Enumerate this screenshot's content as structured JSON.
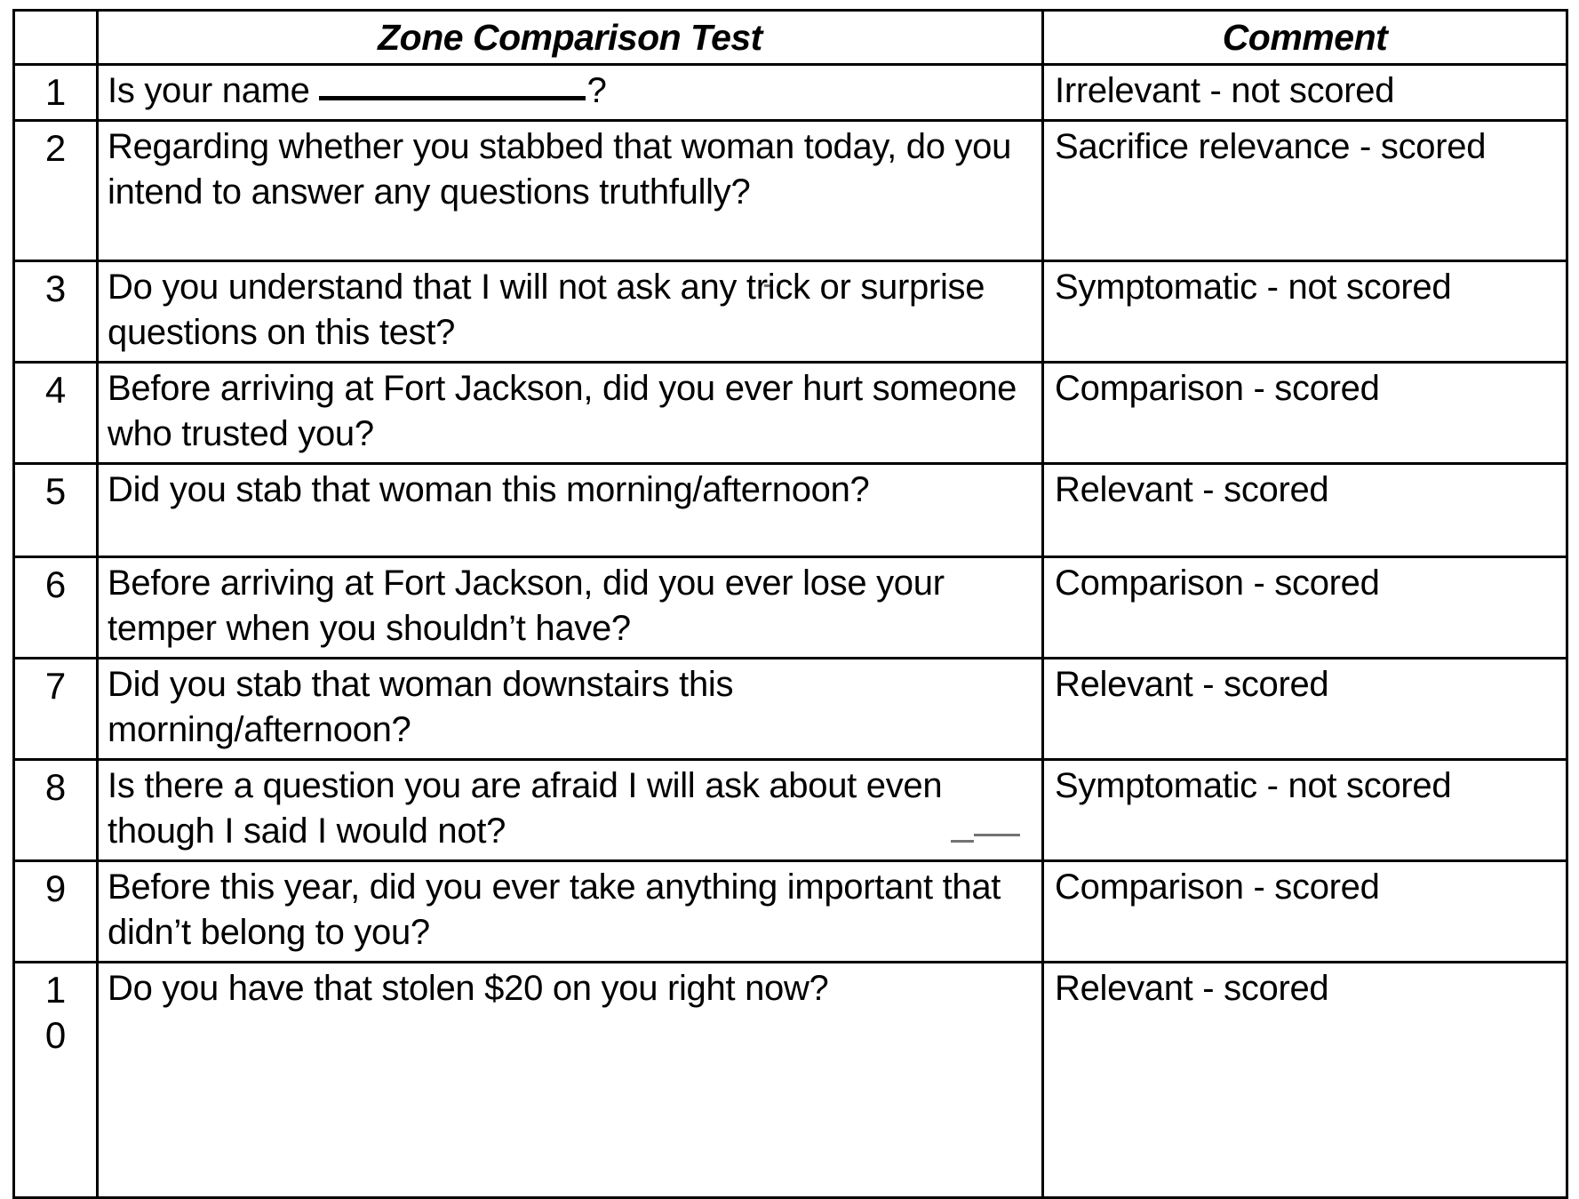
{
  "table": {
    "headers": {
      "number": "",
      "question": "Zone Comparison Test",
      "comment": "Comment"
    },
    "rows": [
      {
        "number": "1",
        "question_before_blank": "Is your name",
        "question_after_blank": "?",
        "has_blank": true,
        "question": "Is your name ______________?",
        "comment": "Irrelevant - not scored"
      },
      {
        "number": "2",
        "question": "Regarding whether you stabbed that woman today, do you intend to answer any questions truthfully?",
        "comment": "Sacrifice relevance - scored"
      },
      {
        "number": "3",
        "question": "Do you understand that I will not ask any trick or surprise questions on this test?",
        "comment": "Symptomatic - not scored"
      },
      {
        "number": "4",
        "question": "Before arriving at Fort Jackson, did you ever hurt someone who trusted you?",
        "comment": "Comparison - scored"
      },
      {
        "number": "5",
        "question": "Did you stab that woman this morning/afternoon?",
        "comment": "Relevant - scored"
      },
      {
        "number": "6",
        "question": "Before arriving at Fort Jackson, did you ever lose your temper when you shouldn’t have?",
        "comment": "Comparison - scored"
      },
      {
        "number": "7",
        "question": "Did you stab that woman downstairs this morning/afternoon?",
        "comment": "Relevant - scored"
      },
      {
        "number": "8",
        "question": "Is there a question you are afraid I will ask about even though I said I would not?",
        "comment": "Symptomatic - not scored"
      },
      {
        "number": "9",
        "question": "Before this year, did you ever take anything important that didn’t belong to you?",
        "comment": "Comparison - scored"
      },
      {
        "number": "1\n0",
        "question": "Do you have that stolen $20 on you right now?",
        "comment": "Relevant - scored"
      }
    ]
  },
  "colors": {
    "ink": "#000000",
    "paper": "#ffffff"
  }
}
